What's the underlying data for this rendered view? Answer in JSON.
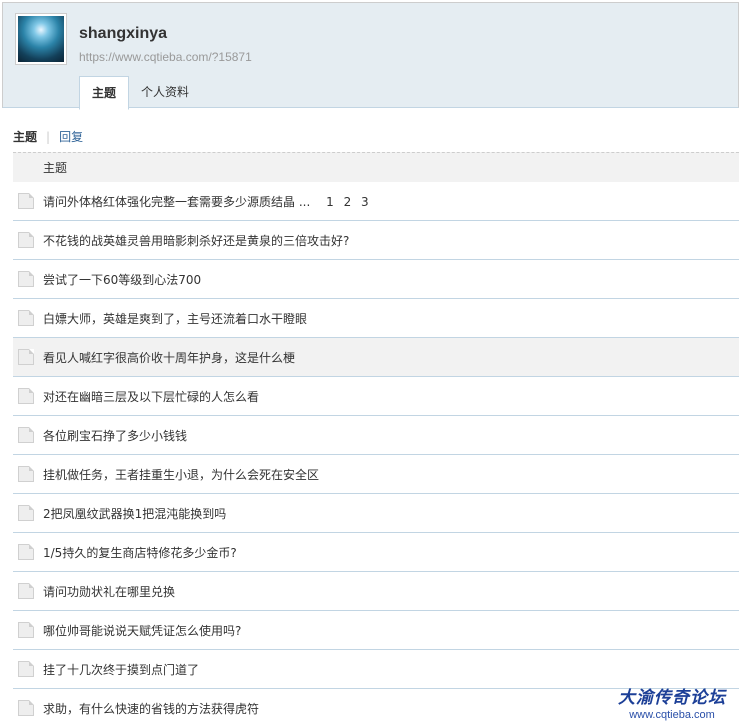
{
  "profile": {
    "username": "shangxinya",
    "url": "https://www.cqtieba.com/?15871"
  },
  "tabs": [
    {
      "label": "主题",
      "active": true
    },
    {
      "label": "个人资料",
      "active": false
    }
  ],
  "subnav": {
    "current": "主题",
    "separator": "|",
    "other": "回复"
  },
  "list_header": "主题",
  "threads": [
    {
      "title": "请问外体格红体强化完整一套需要多少源质结晶 ...",
      "pages": [
        "1",
        "2",
        "3"
      ]
    },
    {
      "title": "不花钱的战英雄灵兽用暗影刺杀好还是黄泉的三倍攻击好?"
    },
    {
      "title": "尝试了一下60等级到心法700"
    },
    {
      "title": "白嫖大师，英雄是爽到了，主号还流着口水干瞪眼"
    },
    {
      "title": "看见人喊红字很高价收十周年护身，这是什么梗"
    },
    {
      "title": "对还在幽暗三层及以下层忙碌的人怎么看"
    },
    {
      "title": "各位刷宝石挣了多少小钱钱"
    },
    {
      "title": "挂机做任务，王者挂重生小退，为什么会死在安全区"
    },
    {
      "title": "2把凤凰纹武器换1把混沌能换到吗"
    },
    {
      "title": "1/5持久的复生商店特修花多少金币?"
    },
    {
      "title": "请问功勋状礼在哪里兑换"
    },
    {
      "title": "哪位帅哥能说说天赋凭证怎么使用吗?"
    },
    {
      "title": "挂了十几次终于摸到点门道了"
    },
    {
      "title": "求助，有什么快速的省钱的方法获得虎符"
    }
  ],
  "watermark": {
    "logo_text": "大渝传奇论坛",
    "url": "www.cqtieba.com"
  },
  "colors": {
    "header_bg": "#e5edf2",
    "row_divider": "#c2d5e3",
    "link": "#336699",
    "watermark": "#1c3f97"
  }
}
